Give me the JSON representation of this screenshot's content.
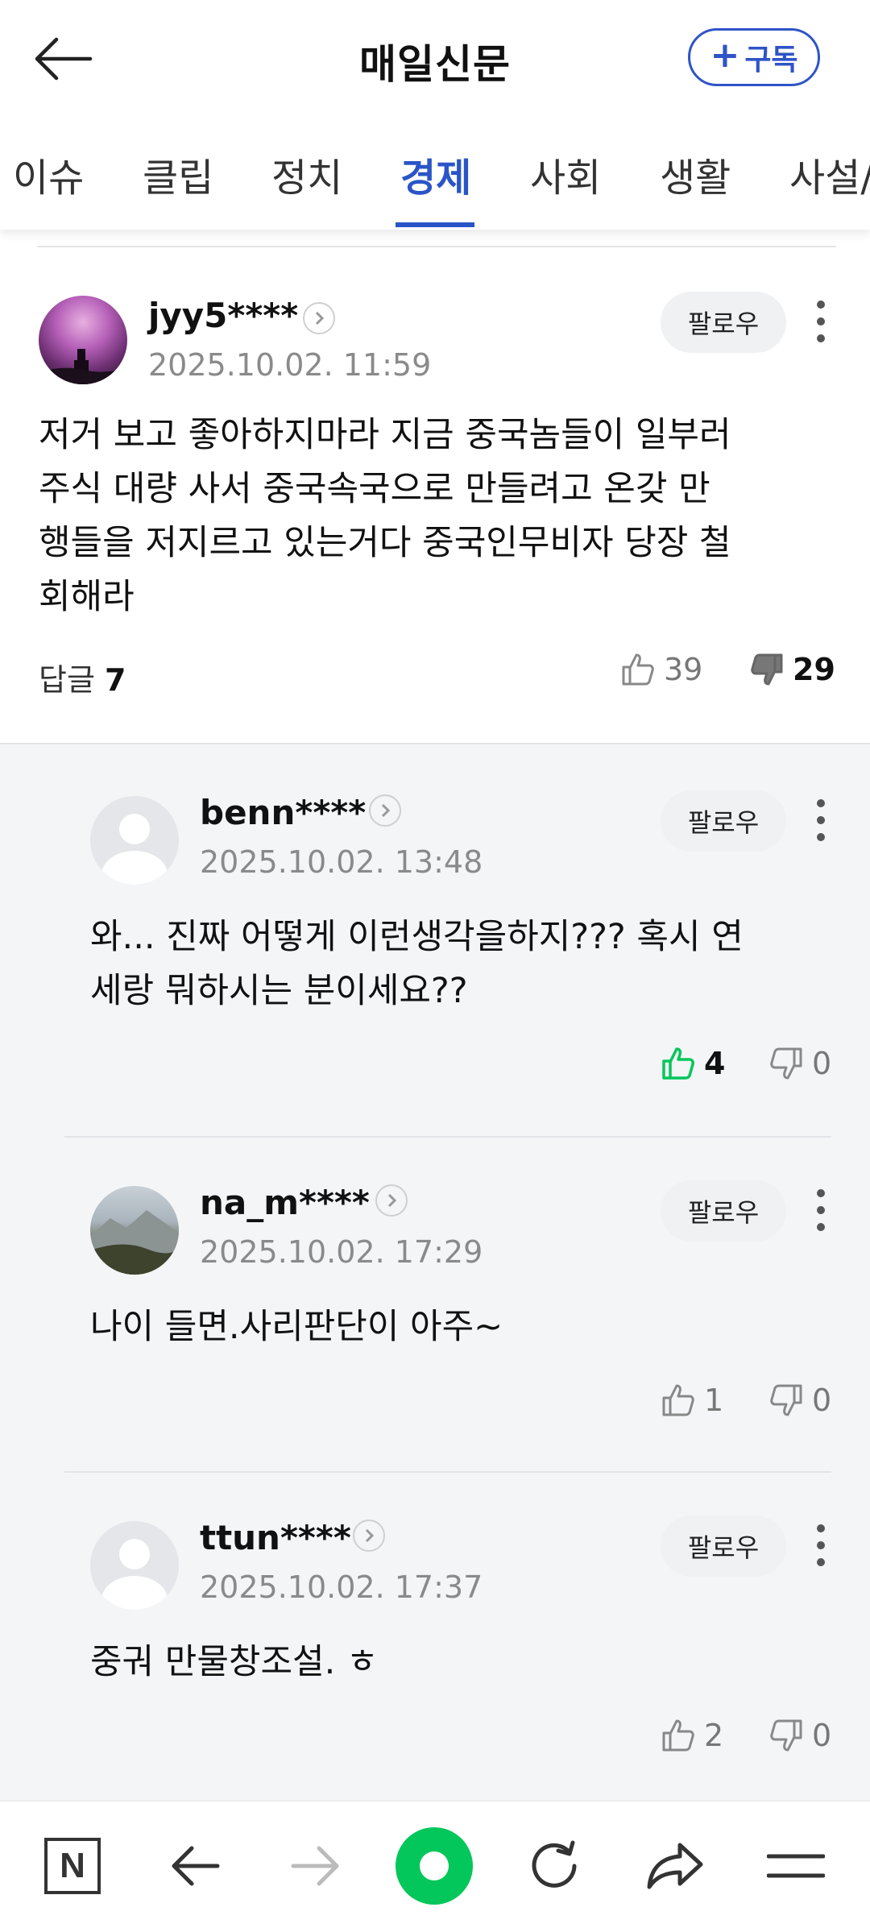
{
  "header": {
    "title": "매일신문",
    "subscribe_label": "구독"
  },
  "tabs": [
    {
      "label": "이슈"
    },
    {
      "label": "클립"
    },
    {
      "label": "정치"
    },
    {
      "label": "경제"
    },
    {
      "label": "사회"
    },
    {
      "label": "생활"
    },
    {
      "label": "사설/"
    }
  ],
  "active_tab": "경제",
  "comment": {
    "username": "jyy5****",
    "timestamp": "2025.10.02. 11:59",
    "follow_label": "팔로우",
    "text_lines": [
      "저거 보고 좋아하지마라 지금 중국놈들이 일부러",
      "주식 대량 사서 중국속국으로 만들려고 온갖 만",
      "행들을 저지르고 있는거다 중국인무비자 당장 철",
      "회해라"
    ],
    "reply_label": "답글",
    "reply_count": "7",
    "likes": "39",
    "dislikes": "29"
  },
  "replies": [
    {
      "username": "benn****",
      "timestamp": "2025.10.02. 13:48",
      "follow_label": "팔로우",
      "text_lines": [
        "와... 진짜 어떻게 이런생각을하지??? 혹시 연",
        "세랑 뭐하시는 분이세요??"
      ],
      "likes": "4",
      "dislikes": "0"
    },
    {
      "username": "na_m****",
      "timestamp": "2025.10.02. 17:29",
      "follow_label": "팔로우",
      "text_lines": [
        "나이 들면.사리판단이 아주~"
      ],
      "likes": "1",
      "dislikes": "0"
    },
    {
      "username": "ttun****",
      "timestamp": "2025.10.02. 17:37",
      "follow_label": "팔로우",
      "text_lines": [
        "중궈 만물창조설. ㅎ"
      ],
      "likes": "2",
      "dislikes": "0"
    }
  ],
  "bottom_nav": {
    "n_label": "N"
  },
  "colors": {
    "accent_blue": "#2a54c8",
    "like_green": "#03c75a",
    "home_green": "#03c75a"
  },
  "icons": [
    "back-arrow-icon",
    "plus-icon",
    "chevron-right-icon",
    "more-vertical-icon",
    "thumbs-up-icon",
    "thumbs-down-icon",
    "nav-n-icon",
    "nav-back-icon",
    "nav-forward-icon",
    "nav-home-icon",
    "nav-refresh-icon",
    "nav-share-icon",
    "nav-menu-icon"
  ]
}
